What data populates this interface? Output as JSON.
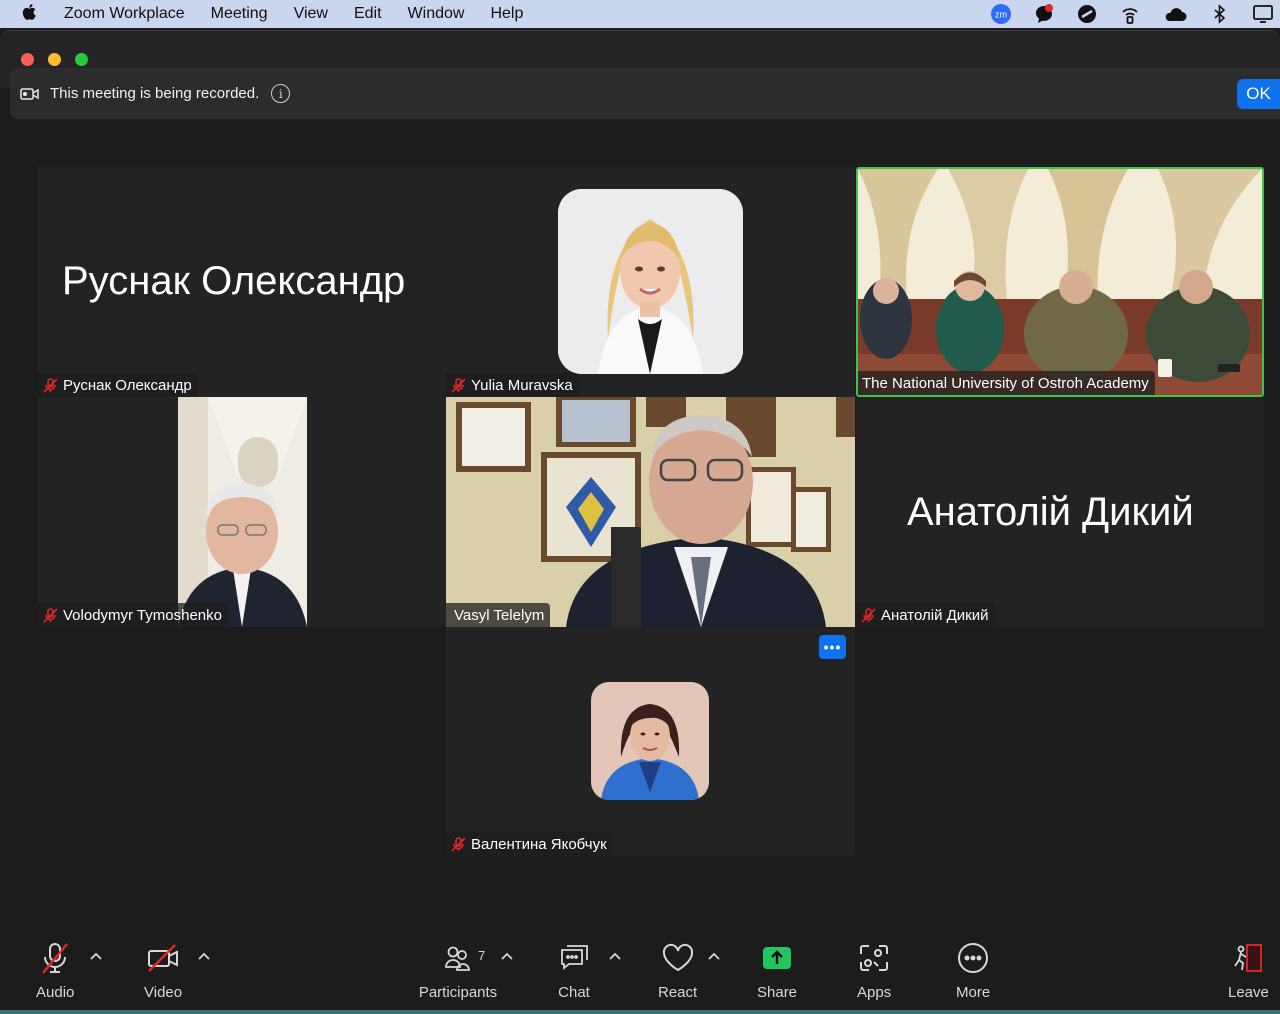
{
  "menubar": {
    "app_name": "Zoom Workplace",
    "items": [
      "Meeting",
      "View",
      "Edit",
      "Window",
      "Help"
    ],
    "status_icons": [
      "zoom-icon",
      "notification-icon",
      "no-entry-icon",
      "wireless-icon",
      "cloud-icon",
      "bluetooth-icon",
      "display-icon"
    ]
  },
  "window": {
    "traffic_lights": [
      "#ff5f57",
      "#febc2e",
      "#28c840"
    ]
  },
  "banner": {
    "text": "This meeting is being recorded.",
    "info_glyph": "i",
    "ok_label": "OK"
  },
  "participants": [
    {
      "name": "Руснак Олександр",
      "display": "name",
      "big_name": "Руснак Олександр",
      "muted": true
    },
    {
      "name": "Yulia Muravska",
      "display": "photo",
      "muted": true
    },
    {
      "name": "The National University of Ostroh Academy",
      "display": "video",
      "muted": false,
      "active_speaker": true
    },
    {
      "name": "Volodymyr Tymoshenko",
      "display": "video",
      "muted": true
    },
    {
      "name": "Vasyl Telelym",
      "display": "video",
      "muted": false
    },
    {
      "name": "Анатолій Дикий",
      "display": "name",
      "big_name": "Анатолій Дикий",
      "muted": true
    },
    {
      "name": "Валентина Якобчук",
      "display": "photo",
      "muted": true
    }
  ],
  "tile_menu_glyph": "•••",
  "toolbar": {
    "audio": "Audio",
    "video": "Video",
    "participants": "Participants",
    "participants_count": "7",
    "chat": "Chat",
    "react": "React",
    "share": "Share",
    "apps": "Apps",
    "more": "More",
    "leave": "Leave"
  },
  "colors": {
    "accent": "#0e72ed",
    "active_speaker": "#3fc44c",
    "muted": "#e02828",
    "share": "#22c55e"
  }
}
